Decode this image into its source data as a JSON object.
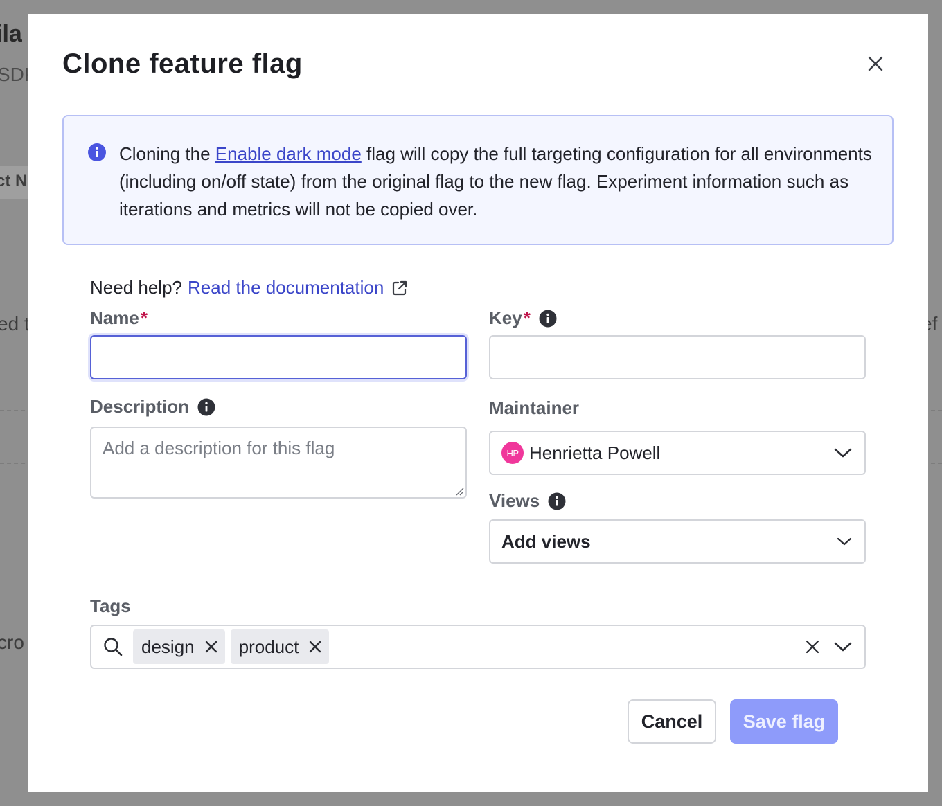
{
  "background": {
    "title_fragment": "ila",
    "sdk_fragment": "SDK",
    "product_fragment": "ct N",
    "left_fragment": "ed t",
    "right_fragment": "ef",
    "bottom_fragment": "cro"
  },
  "modal": {
    "title": "Clone feature flag",
    "info": {
      "prefix": "Cloning the ",
      "flag_link": "Enable dark mode",
      "suffix": " flag will copy the full targeting configuration for all environments (including on/off state) from the original flag to the new flag. Experiment information such as iterations and metrics will not be copied over."
    },
    "help": {
      "prefix": "Need help?",
      "link": "Read the documentation"
    },
    "fields": {
      "name": {
        "label": "Name",
        "required_mark": "*",
        "value": ""
      },
      "key": {
        "label": "Key",
        "required_mark": "*",
        "value": ""
      },
      "description": {
        "label": "Description",
        "value": "",
        "placeholder": "Add a description for this flag"
      },
      "maintainer": {
        "label": "Maintainer",
        "avatar_initials": "HP",
        "value": "Henrietta Powell"
      },
      "views": {
        "label": "Views",
        "value": "Add views"
      },
      "tags": {
        "label": "Tags",
        "items": [
          "design",
          "product"
        ]
      }
    },
    "buttons": {
      "cancel": "Cancel",
      "save": "Save flag"
    }
  },
  "colors": {
    "accent": "#3b46c9",
    "save_button_disabled": "#8e9bfa",
    "info_background": "#f4f6ff",
    "required": "#c0134a",
    "avatar": "#f0379b"
  },
  "icons": {
    "close": "close-icon",
    "info": "info-circle-icon",
    "external_link": "external-link-icon",
    "chevron": "chevron-down-icon",
    "search": "search-icon",
    "remove": "x-icon"
  }
}
